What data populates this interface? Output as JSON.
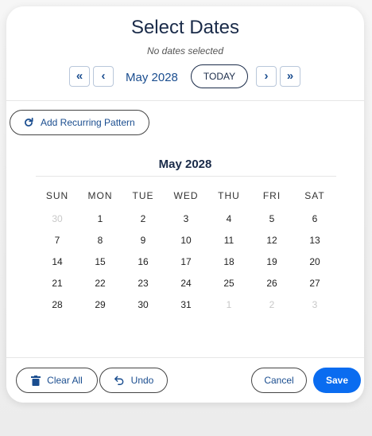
{
  "header": {
    "title": "Select Dates",
    "subtitle": "No dates selected",
    "nav": {
      "prev_year_label": "«",
      "prev_month_label": "‹",
      "month_label": "May 2028",
      "today_label": "TODAY",
      "next_month_label": "›",
      "next_year_label": "»"
    }
  },
  "recurring": {
    "label": "Add Recurring Pattern",
    "icon": "refresh-icon"
  },
  "calendar": {
    "title": "May 2028",
    "weekdays": [
      "SUN",
      "MON",
      "TUE",
      "WED",
      "THU",
      "FRI",
      "SAT"
    ],
    "weeks": [
      [
        {
          "d": "30",
          "muted": true
        },
        {
          "d": "1",
          "muted": false
        },
        {
          "d": "2",
          "muted": false
        },
        {
          "d": "3",
          "muted": false
        },
        {
          "d": "4",
          "muted": false
        },
        {
          "d": "5",
          "muted": false
        },
        {
          "d": "6",
          "muted": false
        }
      ],
      [
        {
          "d": "7",
          "muted": false
        },
        {
          "d": "8",
          "muted": false
        },
        {
          "d": "9",
          "muted": false
        },
        {
          "d": "10",
          "muted": false
        },
        {
          "d": "11",
          "muted": false
        },
        {
          "d": "12",
          "muted": false
        },
        {
          "d": "13",
          "muted": false
        }
      ],
      [
        {
          "d": "14",
          "muted": false
        },
        {
          "d": "15",
          "muted": false
        },
        {
          "d": "16",
          "muted": false
        },
        {
          "d": "17",
          "muted": false
        },
        {
          "d": "18",
          "muted": false
        },
        {
          "d": "19",
          "muted": false
        },
        {
          "d": "20",
          "muted": false
        }
      ],
      [
        {
          "d": "21",
          "muted": false
        },
        {
          "d": "22",
          "muted": false
        },
        {
          "d": "23",
          "muted": false
        },
        {
          "d": "24",
          "muted": false
        },
        {
          "d": "25",
          "muted": false
        },
        {
          "d": "26",
          "muted": false
        },
        {
          "d": "27",
          "muted": false
        }
      ],
      [
        {
          "d": "28",
          "muted": false
        },
        {
          "d": "29",
          "muted": false
        },
        {
          "d": "30",
          "muted": false
        },
        {
          "d": "31",
          "muted": false
        },
        {
          "d": "1",
          "muted": true
        },
        {
          "d": "2",
          "muted": true
        },
        {
          "d": "3",
          "muted": true
        }
      ]
    ]
  },
  "footer": {
    "clear_label": "Clear All",
    "clear_icon": "trash-icon",
    "undo_label": "Undo",
    "undo_icon": "undo-icon",
    "cancel_label": "Cancel",
    "save_label": "Save"
  },
  "colors": {
    "accent": "#0a6cf0",
    "title": "#1a2b49",
    "link": "#1a4d8f",
    "muted_day": "#c8c8c8"
  }
}
